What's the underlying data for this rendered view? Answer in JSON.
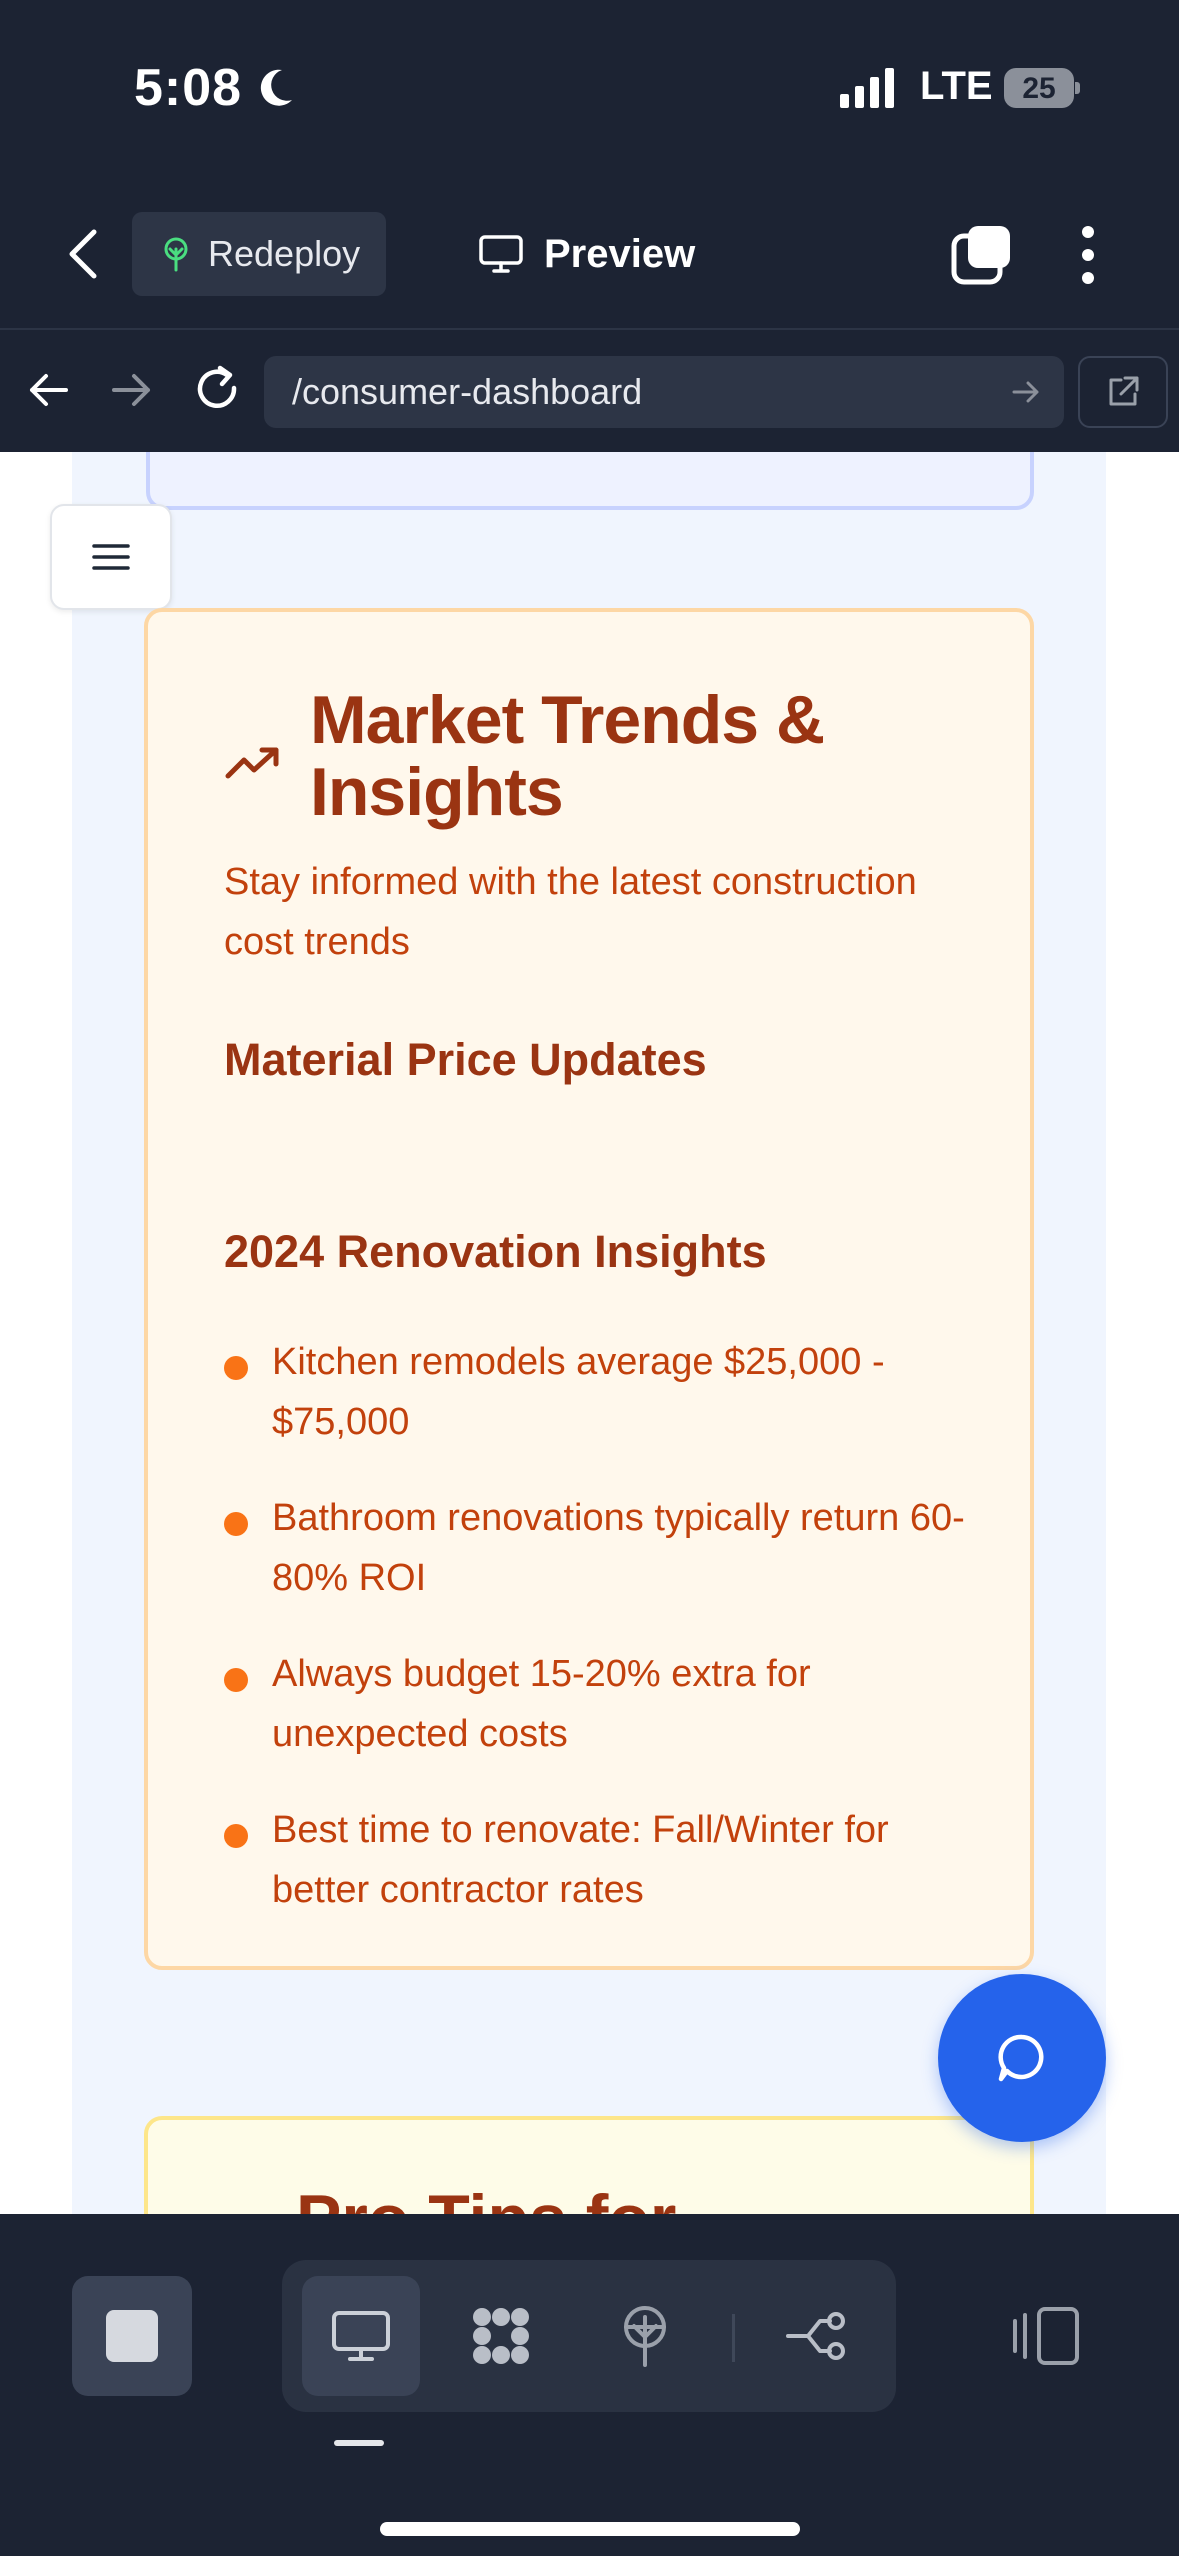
{
  "status_bar": {
    "time": "5:08",
    "network": "LTE",
    "battery": "25"
  },
  "toolbar": {
    "redeploy_label": "Redeploy",
    "preview_label": "Preview"
  },
  "browser": {
    "url": "/consumer-dashboard"
  },
  "market_card": {
    "title": "Market Trends & Insights",
    "subtitle": "Stay informed with the latest construction cost trends",
    "material_heading": "Material Price Updates",
    "insights_heading": "2024 Renovation Insights",
    "insights": [
      "Kitchen remodels average $25,000 - $75,000",
      "Bathroom renovations typically return 60-80% ROI",
      "Always budget 15-20% extra for unexpected costs",
      "Best time to renovate: Fall/Winter for better contractor rates"
    ]
  },
  "next_card": {
    "title": "Pro Tips for"
  },
  "colors": {
    "accent": "#f97316",
    "heading": "#9a3412",
    "body_text": "#c2410c",
    "chat_button": "#2563eb",
    "chrome": "#1c2333"
  }
}
